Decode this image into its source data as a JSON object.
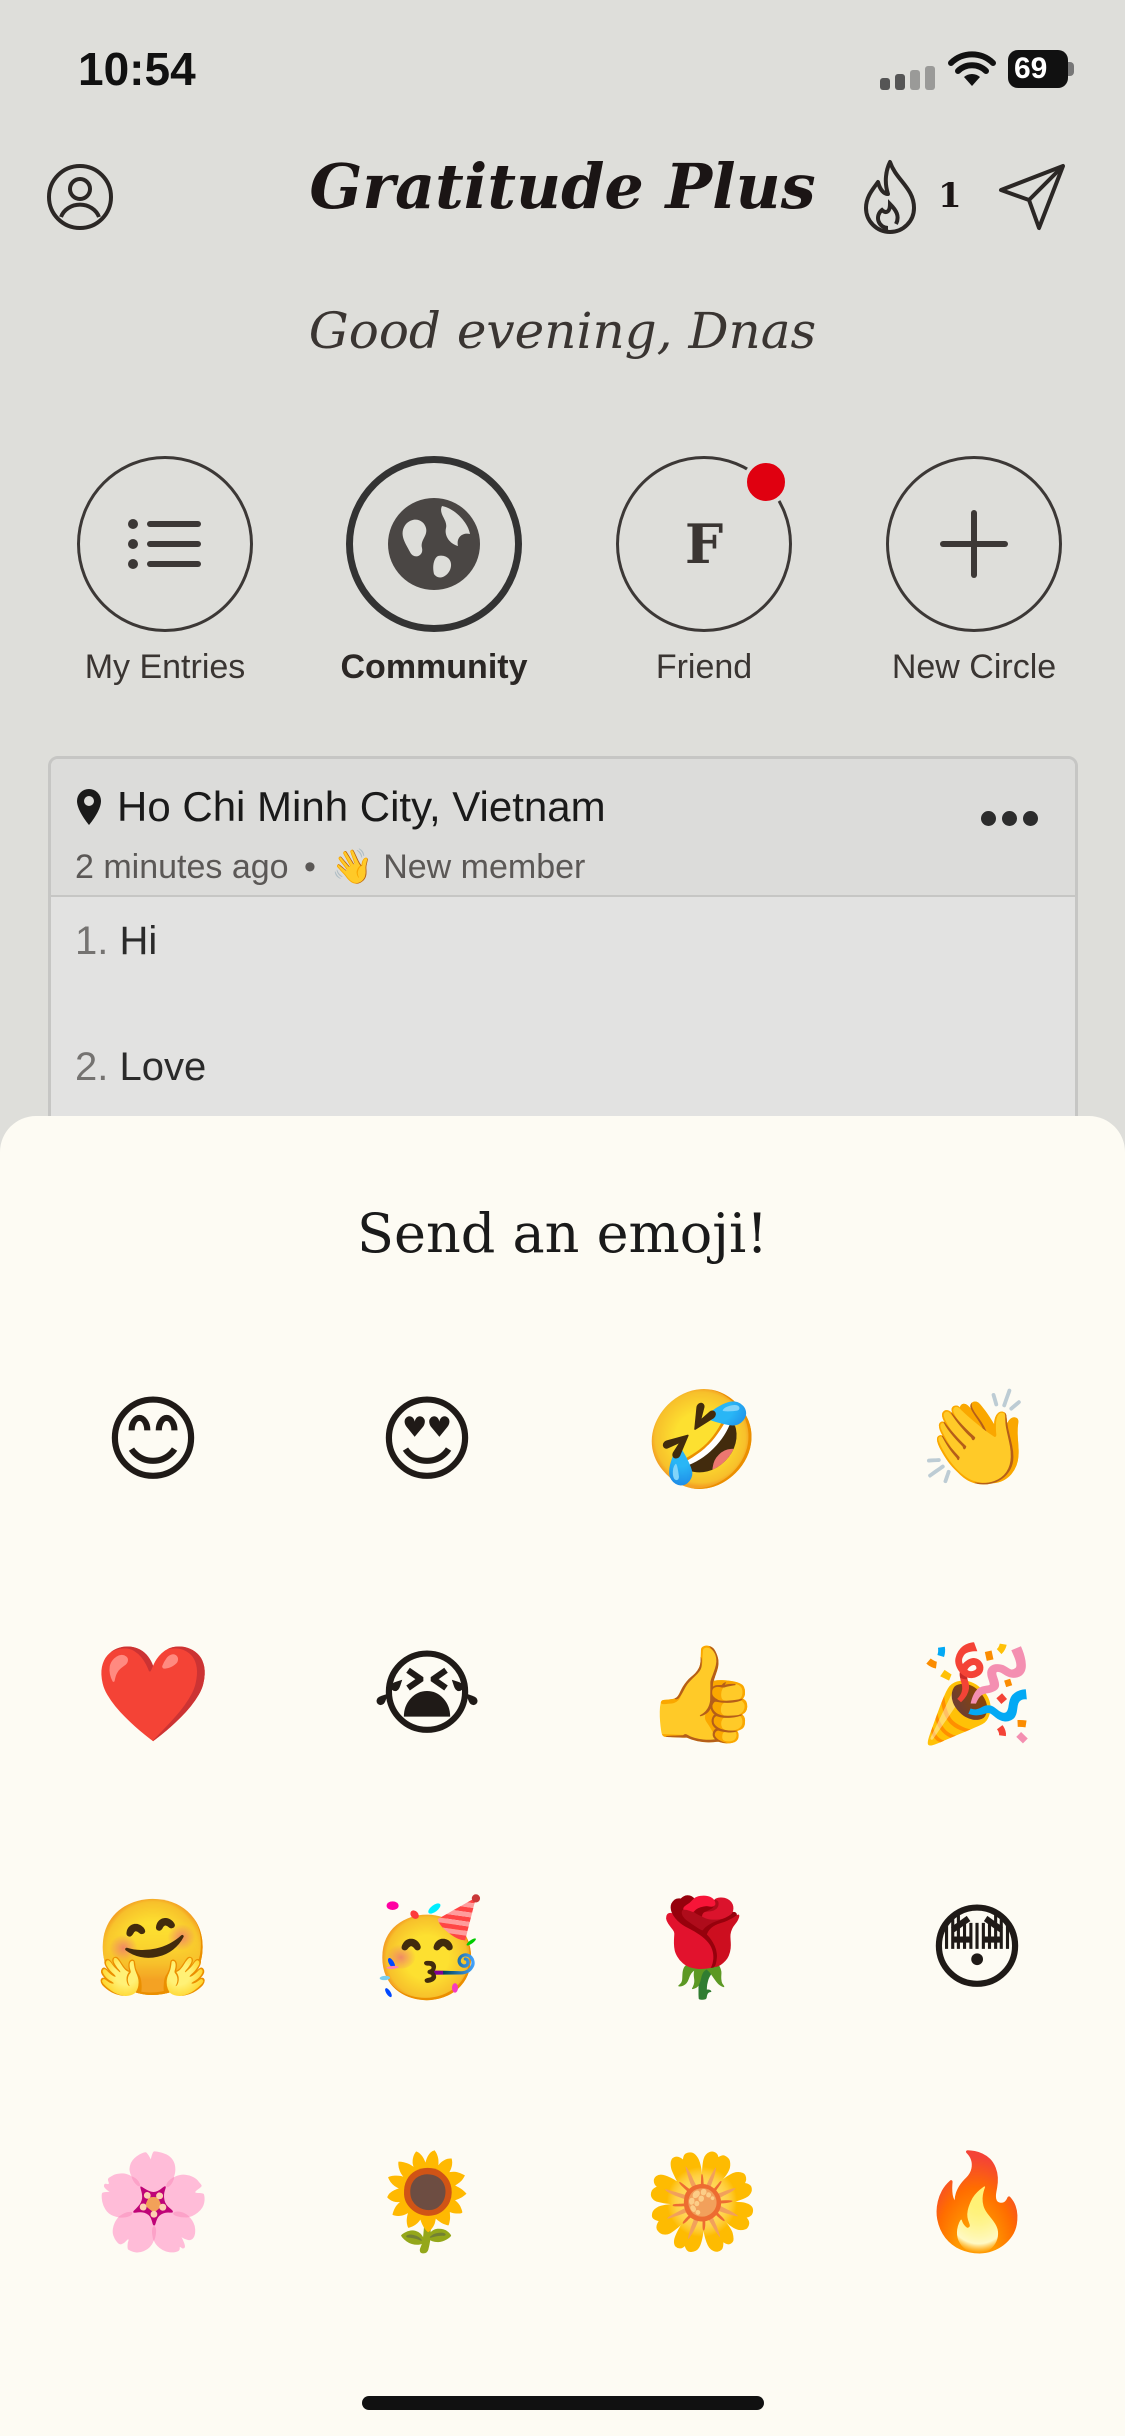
{
  "status_bar": {
    "time": "10:54",
    "battery": "69"
  },
  "header": {
    "title": "Gratitude Plus",
    "streak_count": "1"
  },
  "greeting": "Good evening, Dnas",
  "circles": [
    {
      "label": "My Entries",
      "icon": "list-icon",
      "active": false
    },
    {
      "label": "Community",
      "icon": "globe-icon",
      "active": true
    },
    {
      "label": "Friend",
      "letter": "F",
      "has_notification": true,
      "active": false
    },
    {
      "label": "New Circle",
      "icon": "plus-icon",
      "active": false
    }
  ],
  "entry": {
    "location": "Ho Chi Minh City, Vietnam",
    "time_ago": "2 minutes ago",
    "separator": "•",
    "badge_emoji": "👋",
    "badge_text": "New member",
    "items": [
      {
        "number": "1.",
        "text": "Hi"
      },
      {
        "number": "2.",
        "text": "Love"
      }
    ]
  },
  "emoji_sheet": {
    "title": "Send an emoji!",
    "emojis": [
      "😊",
      "😍",
      "🤣",
      "👏",
      "❤️",
      "😭",
      "👍",
      "🎉",
      "🤗",
      "🥳",
      "🌹",
      "😳",
      "🌸",
      "🌻",
      "🌼",
      "🔥"
    ]
  },
  "colors": {
    "background": "#dededa",
    "sheet": "#fdfbf3",
    "notification": "#e00010"
  }
}
